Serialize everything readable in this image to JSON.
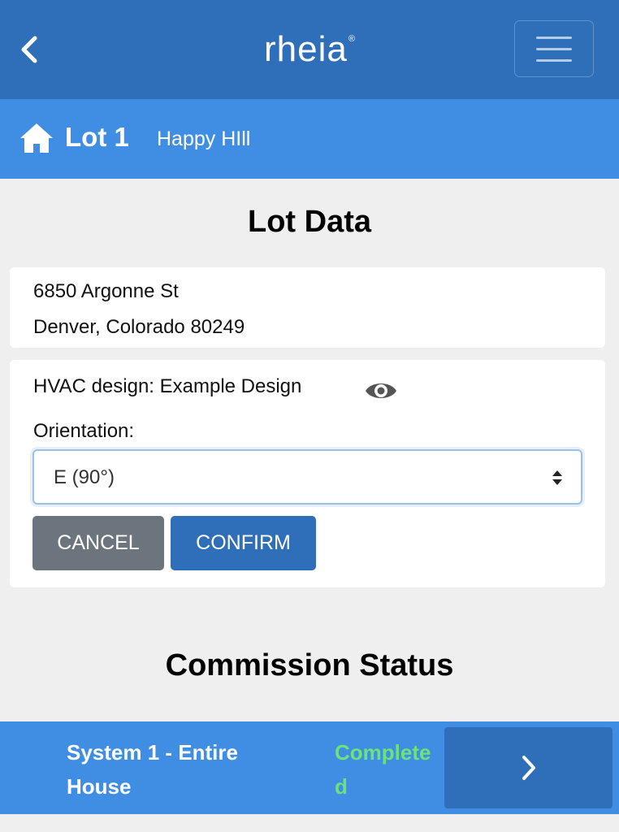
{
  "header": {
    "logo_text": "rheia",
    "logo_mark": "®",
    "back_icon": "chevron-left-icon",
    "menu_icon": "hamburger-menu-icon"
  },
  "lot": {
    "title": "Lot 1",
    "community": "Happy HIll",
    "home_icon": "home-icon"
  },
  "lot_data": {
    "heading": "Lot Data",
    "address_line1": "6850 Argonne St",
    "address_line2": "Denver, Colorado 80249"
  },
  "design": {
    "hvac_label": "HVAC design: Example Design",
    "view_icon": "eye-icon",
    "orientation_label": "Orientation:",
    "orientation_value": "E (90°)",
    "cancel_label": "CANCEL",
    "confirm_label": "CONFIRM"
  },
  "commission": {
    "heading": "Commission Status",
    "systems": [
      {
        "name": "System 1 - Entire House",
        "status": "Completed"
      }
    ]
  },
  "colors": {
    "header_bg": "#2f6eb8",
    "subheader_bg": "#3f8ee3",
    "status_complete": "#6ee27a",
    "cancel_bg": "#6c757d"
  }
}
